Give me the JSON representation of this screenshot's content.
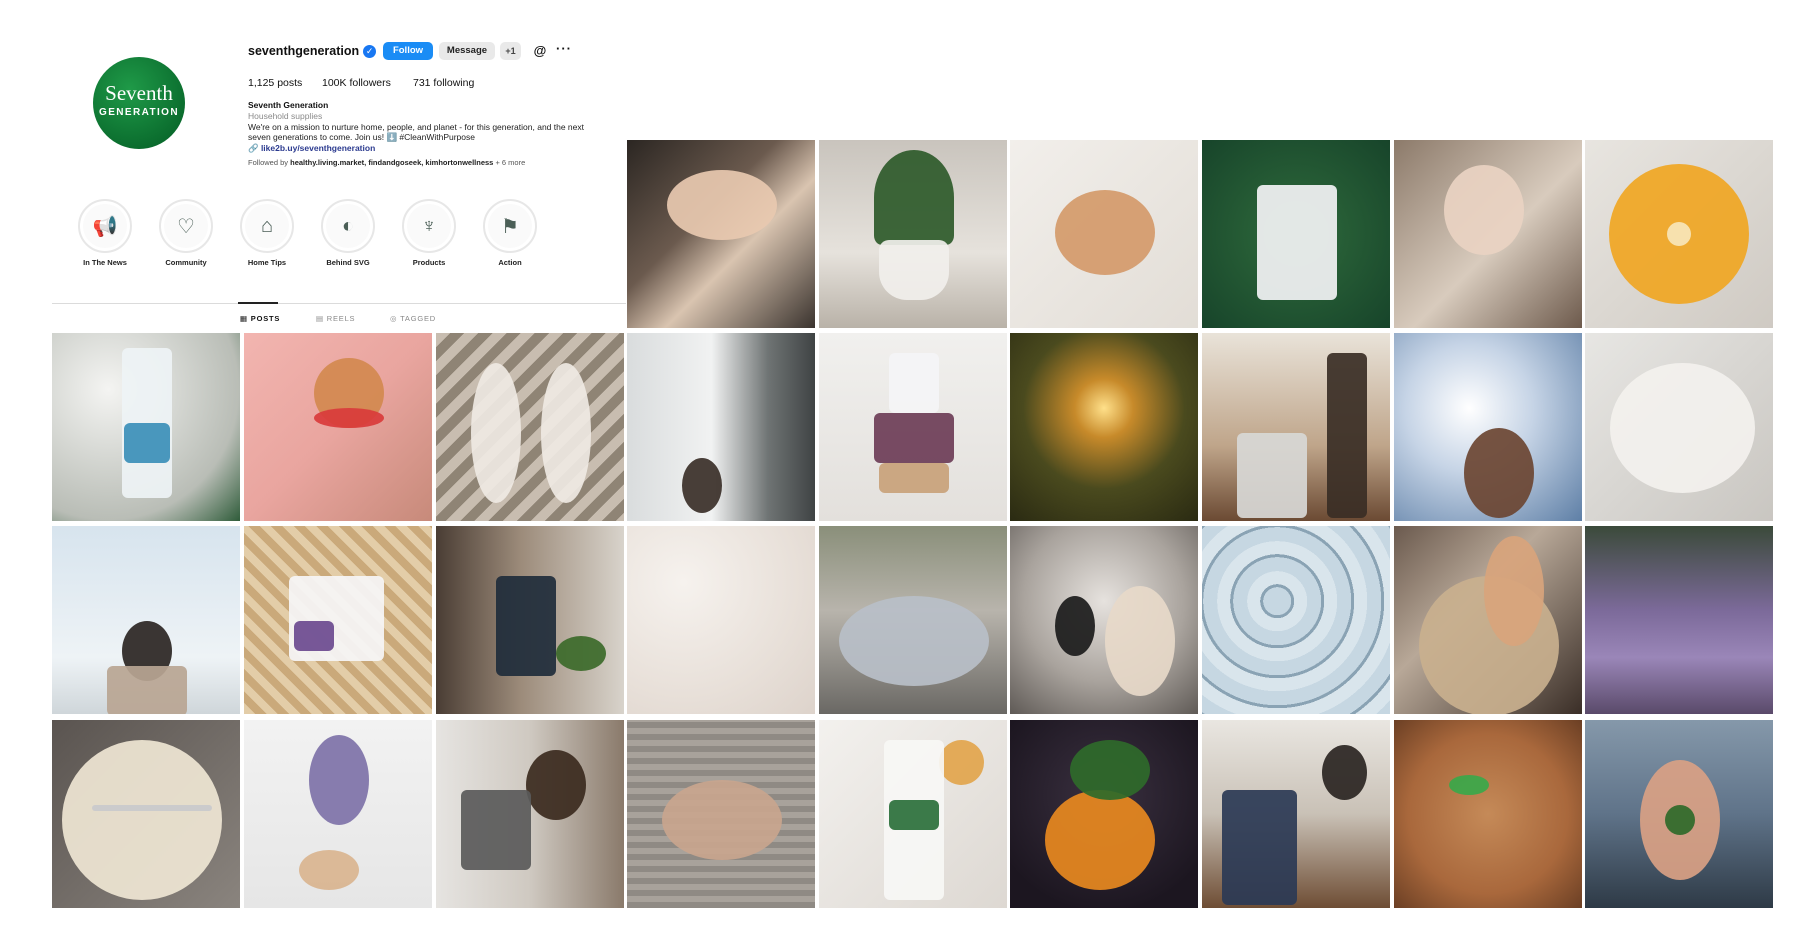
{
  "profile": {
    "avatar_line1": "Seventh",
    "avatar_line2": "GENERATION",
    "username": "seventhgeneration",
    "verified_mark": "✓",
    "follow_label": "Follow",
    "message_label": "Message",
    "add_user_label": "+1",
    "threads_icon": "@",
    "more_icon": "···",
    "posts": "1,125 posts",
    "followers": "100K followers",
    "following": "731 following",
    "display_name": "Seventh Generation",
    "category": "Household supplies",
    "bio_line1": "We're on a mission to nurture home, people, and planet - for this generation, and the next",
    "bio_line2": "seven generations to come. Join us! ⬇️ #CleanWithPurpose",
    "link": "🔗 like2b.uy/seventhgeneration",
    "followed_prefix": "Followed by ",
    "followed_names": "healthy.living.market, findandgoseek, kimhortonwellness",
    "followed_suffix": " + 6 more"
  },
  "highlights": [
    {
      "label": "In The News",
      "icon": "megaphone-icon",
      "glyph": "📢"
    },
    {
      "label": "Community",
      "icon": "heart-icon",
      "glyph": "♡"
    },
    {
      "label": "Home Tips",
      "icon": "house-icon",
      "glyph": "⌂"
    },
    {
      "label": "Behind SVG",
      "icon": "globe-icon",
      "glyph": "◐"
    },
    {
      "label": "Products",
      "icon": "bottle-icon",
      "glyph": "♆"
    },
    {
      "label": "Action",
      "icon": "flag-icon",
      "glyph": "⚑"
    }
  ],
  "tabs": [
    {
      "label": "▦ POSTS",
      "active": true
    },
    {
      "label": "▤ REELS",
      "active": false
    },
    {
      "label": "◎ TAGGED",
      "active": false
    }
  ],
  "colors": {
    "accent": "#1a8cf5",
    "brand_green": "#0a6b2d"
  },
  "posts": [
    {
      "subject": "hands-washing"
    },
    {
      "subject": "potted-plant"
    },
    {
      "subject": "stain-on-fabric"
    },
    {
      "subject": "product-pouch-green"
    },
    {
      "subject": "child-baking"
    },
    {
      "subject": "orange-slice"
    },
    {
      "subject": "dish-soap-bottle"
    },
    {
      "subject": "child-watermelon"
    },
    {
      "subject": "socks"
    },
    {
      "subject": "cat-doorway"
    },
    {
      "subject": "pouch-on-folded-clothes"
    },
    {
      "subject": "sunset-tree"
    },
    {
      "subject": "man-dishwasher"
    },
    {
      "subject": "hand-sky"
    },
    {
      "subject": "white-sweater"
    },
    {
      "subject": "woman-sky"
    },
    {
      "subject": "pouch-on-sweater"
    },
    {
      "subject": "man-kitchen"
    },
    {
      "subject": "foam-texture"
    },
    {
      "subject": "teddy-bear"
    },
    {
      "subject": "washing-machine"
    },
    {
      "subject": "bubbles"
    },
    {
      "subject": "cooking-pot"
    },
    {
      "subject": "lavender-field"
    },
    {
      "subject": "dirty-bowl"
    },
    {
      "subject": "lavender-bouquet"
    },
    {
      "subject": "man-microwave"
    },
    {
      "subject": "elderly-hands"
    },
    {
      "subject": "all-purpose-spray"
    },
    {
      "subject": "mandarin"
    },
    {
      "subject": "couple-sink"
    },
    {
      "subject": "messy-plate"
    },
    {
      "subject": "hand-leaf"
    }
  ]
}
